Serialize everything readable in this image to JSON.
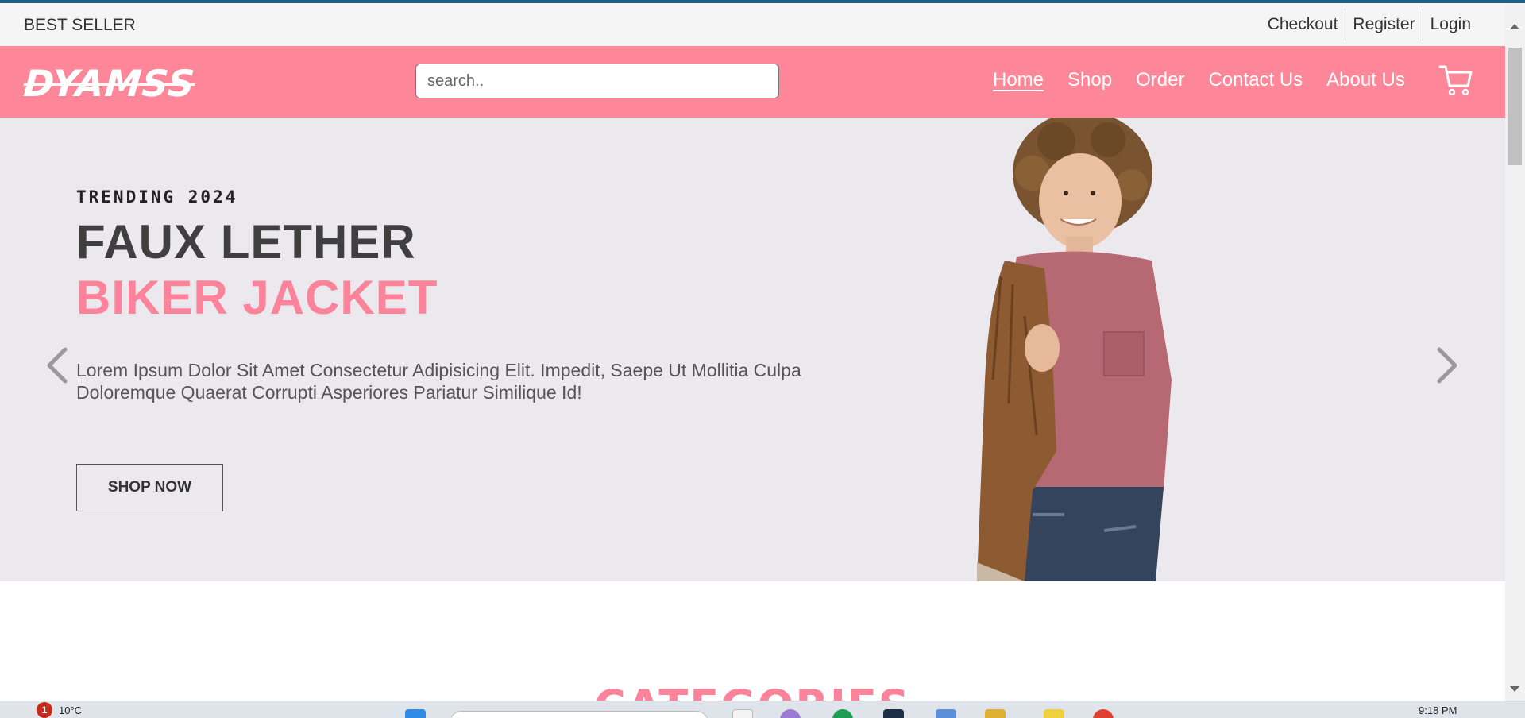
{
  "topbar": {
    "brand_tag": "BEST SELLER",
    "links": [
      "Checkout",
      "Register",
      "Login"
    ]
  },
  "navbar": {
    "logo": "DYAMSS",
    "search_placeholder": "search..",
    "links": [
      "Home",
      "Shop",
      "Order",
      "Contact Us",
      "About Us"
    ],
    "active_link": "Home",
    "cart_icon": "cart-icon"
  },
  "hero": {
    "eyebrow": "TRENDING 2024",
    "title_line1": "FAUX LETHER",
    "title_line2": "BIKER JACKET",
    "description": "Lorem Ipsum Dolor Sit Amet Consectetur Adipisicing Elit. Impedit, Saepe Ut Mollitia Culpa Doloremque Quaerat Corrupti Asperiores Pariatur Similique Id!",
    "cta_label": "SHOP NOW",
    "prev_icon": "chevron-left-icon",
    "next_icon": "chevron-right-icon"
  },
  "section": {
    "categories_title": "CATEGORIES"
  },
  "taskbar": {
    "notification_count": "1",
    "weather": "10°C",
    "time": "9:18 PM"
  },
  "colors": {
    "brand_pink": "#fd8799",
    "accent_pink_text": "#fc8399",
    "hero_background": "#ebe9ed",
    "title_dark": "#3f3f3f",
    "top_accent": "#1f5f86"
  }
}
